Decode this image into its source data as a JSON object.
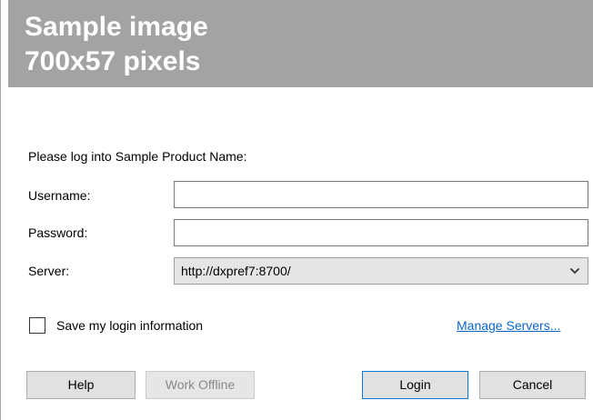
{
  "banner": {
    "line1": "Sample image",
    "line2": "700x57 pixels"
  },
  "login": {
    "prompt": "Please log into Sample Product Name:",
    "username_label": "Username:",
    "username_value": "",
    "password_label": "Password:",
    "password_value": "",
    "server_label": "Server:",
    "server_value": "http://dxpref7:8700/",
    "save_label": "Save my login information",
    "save_checked": false,
    "manage_servers_label": "Manage Servers..."
  },
  "buttons": {
    "help": "Help",
    "work_offline": "Work Offline",
    "login": "Login",
    "cancel": "Cancel"
  },
  "colors": {
    "banner_bg": "#a3a3a3",
    "link": "#0a66c8",
    "default_button_border": "#0a78d7"
  },
  "icons": {
    "dropdown": "chevron-down-icon"
  }
}
